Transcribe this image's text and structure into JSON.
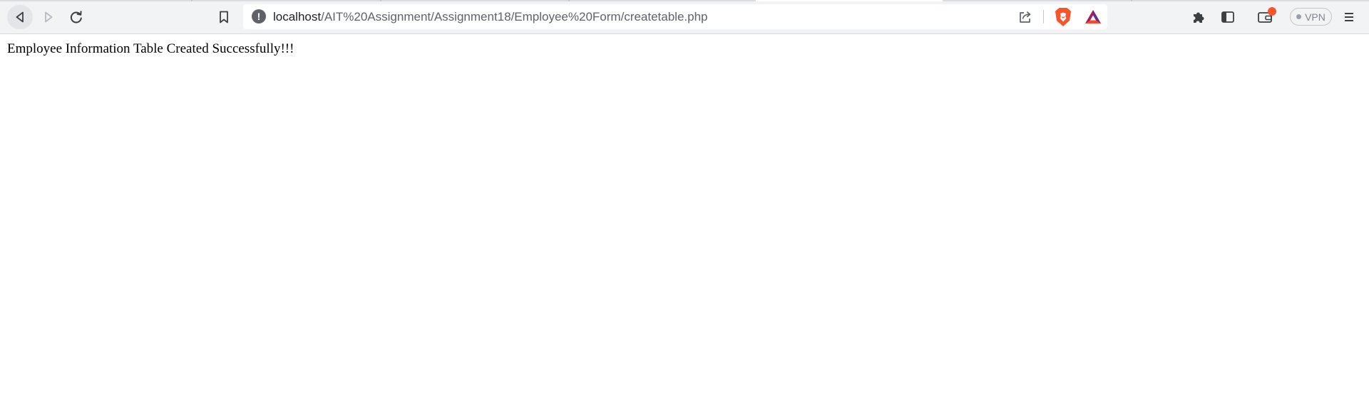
{
  "browser": {
    "address_bar": {
      "url_host": "localhost",
      "url_path": "/AIT%20Assignment/Assignment18/Employee%20Form/createtable.php",
      "site_info_glyph": "!"
    },
    "vpn_label": "VPN",
    "icons": {
      "back": "back-arrow-icon",
      "forward": "forward-arrow-icon",
      "reload": "reload-icon",
      "bookmark": "bookmark-icon",
      "site_info": "info-icon",
      "share": "share-icon",
      "shield": "brave-shield-icon",
      "rewards": "bat-rewards-icon",
      "extensions": "puzzle-icon",
      "sidebar": "sidebar-icon",
      "wallet": "wallet-icon",
      "menu": "hamburger-menu-icon"
    },
    "colors": {
      "toolbar": "#f1f3f4",
      "brave_orange": "#fb542b",
      "notification": "#fb542b"
    }
  },
  "page": {
    "message": "Employee Information Table Created Successfully!!!"
  }
}
